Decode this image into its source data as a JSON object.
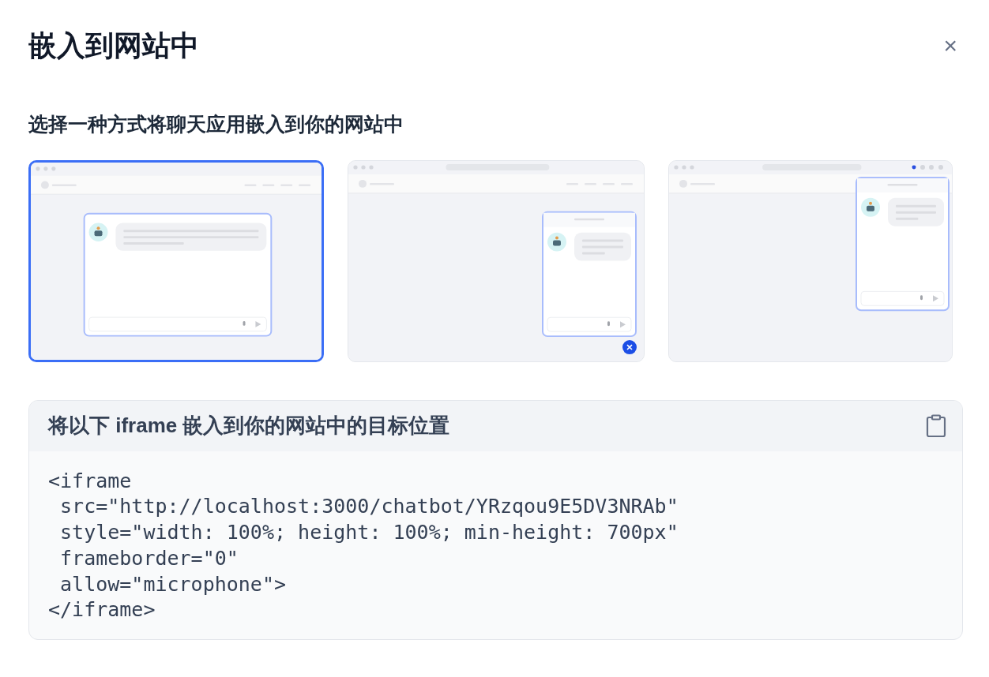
{
  "dialog": {
    "title": "嵌入到网站中",
    "close": "×"
  },
  "prompt": "选择一种方式将聊天应用嵌入到你的网站中",
  "options": [
    {
      "kind": "centered",
      "selected": true
    },
    {
      "kind": "bubble",
      "selected": false
    },
    {
      "kind": "extension",
      "selected": false
    }
  ],
  "code_panel": {
    "heading": "将以下 iframe 嵌入到你的网站中的目标位置",
    "code_lines": [
      "<iframe",
      " src=\"http://localhost:3000/chatbot/YRzqou9E5DV3NRAb\"",
      " style=\"width: 100%; height: 100%; min-height: 700px\"",
      " frameborder=\"0\"",
      " allow=\"microphone\">",
      "</iframe>"
    ]
  }
}
